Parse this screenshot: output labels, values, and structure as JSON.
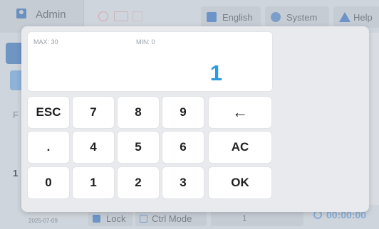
{
  "header": {
    "user_name": "Admin",
    "language_label": "English",
    "system_label": "System",
    "help_label": "Help"
  },
  "sidebar": {
    "text_1": "F",
    "text_2": "1"
  },
  "footer": {
    "date": "2025-07-09",
    "lock_label": "Lock",
    "ctrl_mode_label": "Ctrl Mode",
    "field_value": "1",
    "timer": "00:00:00"
  },
  "keypad": {
    "max_label": "MAX: 30",
    "min_label": "MIN: 0",
    "value": "1",
    "keys": {
      "esc": "ESC",
      "k7": "7",
      "k8": "8",
      "k9": "9",
      "backspace": "←",
      "dot": ".",
      "k4": "4",
      "k5": "5",
      "k6": "6",
      "ac": "AC",
      "k0": "0",
      "k1": "1",
      "k2": "2",
      "k3": "3",
      "ok": "OK"
    }
  },
  "colors": {
    "accent": "#2f9ae0",
    "dialog_bg": "#e8eaed",
    "key_bg": "#ffffff"
  }
}
